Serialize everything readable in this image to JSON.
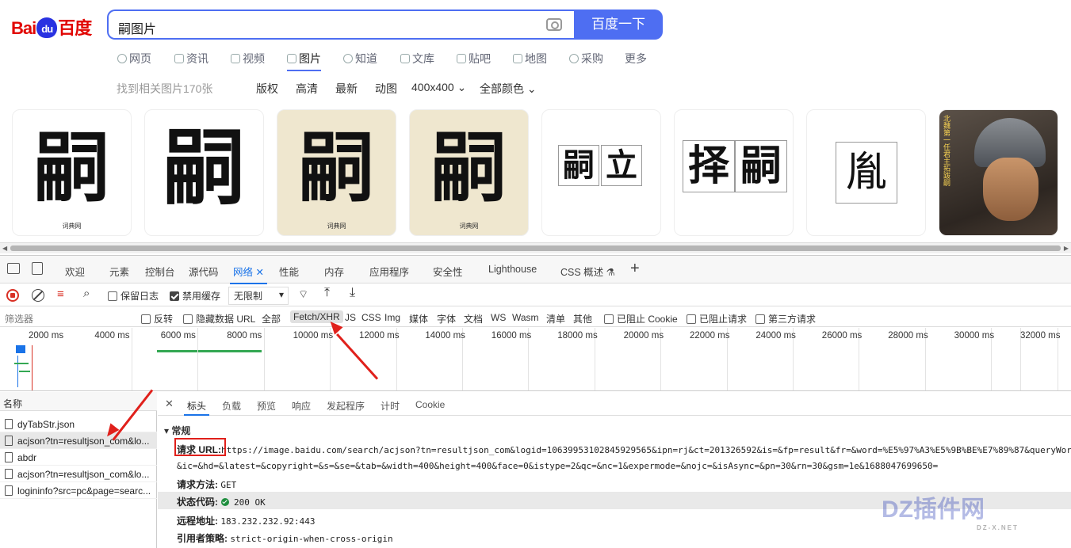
{
  "baidu": {
    "logo": {
      "bai": "Bai",
      "du": "du",
      "cn": "百度"
    },
    "query": "嗣图片",
    "search_button": "百度一下",
    "nav": [
      "网页",
      "资讯",
      "视频",
      "图片",
      "知道",
      "文库",
      "贴吧",
      "地图",
      "采购",
      "更多"
    ],
    "filters": {
      "count": "找到相关图片170张",
      "items": [
        "版权",
        "高清",
        "最新",
        "动图",
        "400x400",
        "全部颜色"
      ]
    },
    "images": [
      {
        "glyph": "嗣",
        "watermark": "词典网"
      },
      {
        "glyph": "嗣",
        "watermark": ""
      },
      {
        "glyph": "嗣",
        "watermark": "词典网"
      },
      {
        "glyph": "嗣",
        "watermark": "词典网"
      },
      {
        "pair": [
          "嗣",
          "立"
        ]
      },
      {
        "pair": [
          "择",
          "嗣"
        ]
      },
      {
        "single": "胤"
      },
      {
        "caption": "北魏第一任君主拓跋嗣"
      }
    ]
  },
  "devtools": {
    "tabs": [
      "欢迎",
      "元素",
      "控制台",
      "源代码",
      "网络",
      "性能",
      "内存",
      "应用程序",
      "安全性",
      "Lighthouse",
      "CSS 概述"
    ],
    "toolbar": {
      "preserve_log": "保留日志",
      "disable_cache": "禁用缓存",
      "throttle": "无限制"
    },
    "filter": {
      "placeholder": "筛选器",
      "invert": "反转",
      "hide_data_url": "隐藏数据 URL",
      "types": [
        "全部",
        "Fetch/XHR",
        "JS",
        "CSS",
        "Img",
        "媒体",
        "字体",
        "文档",
        "WS",
        "Wasm",
        "清单",
        "其他"
      ],
      "blocked_cookies": "已阻止 Cookie",
      "blocked_requests": "已阻止请求",
      "third_party": "第三方请求"
    },
    "timeline_ticks": [
      "2000 ms",
      "4000 ms",
      "6000 ms",
      "8000 ms",
      "10000 ms",
      "12000 ms",
      "14000 ms",
      "16000 ms",
      "18000 ms",
      "20000 ms",
      "22000 ms",
      "24000 ms",
      "26000 ms",
      "28000 ms",
      "30000 ms",
      "32000 ms"
    ],
    "request_list": {
      "header": "名称",
      "items": [
        "dyTabStr.json",
        "acjson?tn=resultjson_com&lo...",
        "abdr",
        "acjson?tn=resultjson_com&lo...",
        "logininfo?src=pc&page=searc..."
      ]
    },
    "details": {
      "tabs": [
        "标头",
        "负载",
        "预览",
        "响应",
        "发起程序",
        "计时",
        "Cookie"
      ],
      "section": "常规",
      "request_url_label": "请求 URL:",
      "request_url": "https://image.baidu.com/search/acjson?tn=resultjson_com&logid=10639953102845929565&ipn=rj&ct=201326592&is=&fp=result&fr=&word=%E5%97%A3%E5%9B%BE%E7%89%87&queryWor",
      "request_url_cont": "&ic=&hd=&latest=&copyright=&s=&se=&tab=&width=400&height=400&face=0&istype=2&qc=&nc=1&expermode=&nojc=&isAsync=&pn=30&rn=30&gsm=1e&1688047699650=",
      "method_label": "请求方法:",
      "method": "GET",
      "status_label": "状态代码:",
      "status": "200 OK",
      "remote_label": "远程地址:",
      "remote": "183.232.232.92:443",
      "referrer_label": "引用者策略:",
      "referrer": "strict-origin-when-cross-origin"
    }
  },
  "watermark": {
    "text": "DZ插件网",
    "sub": "DZ-X.NET"
  }
}
